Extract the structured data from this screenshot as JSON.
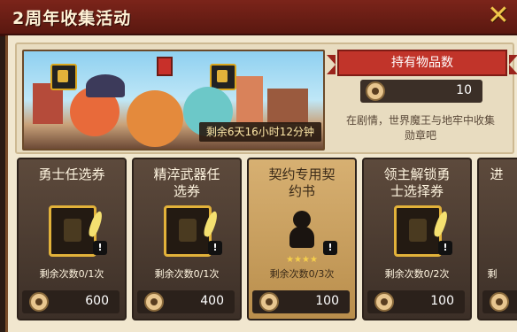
{
  "header": {
    "title": "2周年收集活动",
    "close_icon": "close-icon"
  },
  "banner": {
    "timer": "剩余6天16小时12分钟"
  },
  "holdings": {
    "title": "持有物品数",
    "count": "10",
    "description_line1": "在剧情，世界魔王与地牢中收集",
    "description_line2": "勋章吧"
  },
  "cards": [
    {
      "title_line1": "勇士任选券",
      "title_line2": "",
      "remaining": "剩余次数0/1次",
      "price": "600",
      "stars": ""
    },
    {
      "title_line1": "精淬武器任",
      "title_line2": "选券",
      "remaining": "剩余次数0/1次",
      "price": "400",
      "stars": ""
    },
    {
      "title_line1": "契约专用契",
      "title_line2": "约书",
      "remaining": "剩余次数0/3次",
      "price": "100",
      "stars": "★★★★"
    },
    {
      "title_line1": "领主解锁勇",
      "title_line2": "士选择券",
      "remaining": "剩余次数0/2次",
      "price": "100",
      "stars": ""
    },
    {
      "title_line1": "进",
      "title_line2": "",
      "remaining": "剩",
      "price": "",
      "stars": ""
    }
  ],
  "colors": {
    "accent": "#e2b23a",
    "header": "#7b241a",
    "ribbon": "#c1342a"
  }
}
